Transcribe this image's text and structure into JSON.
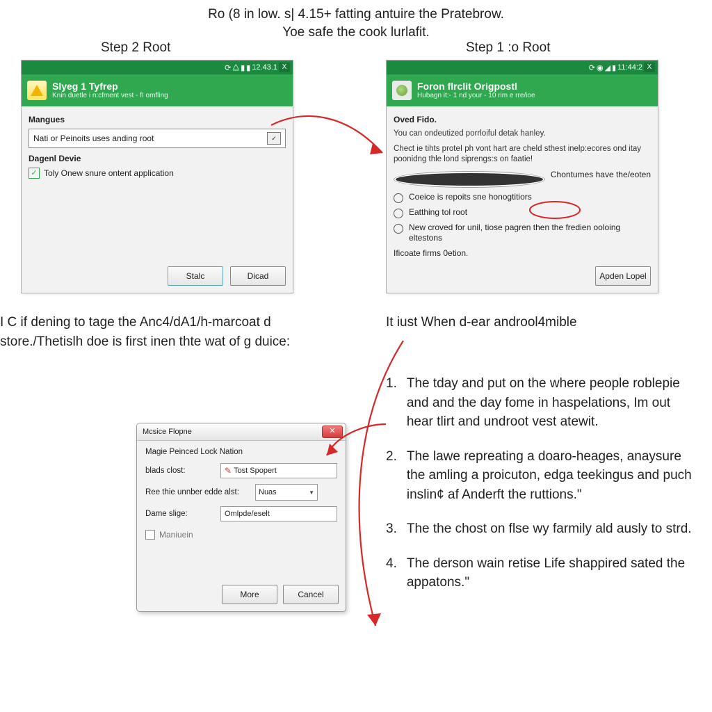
{
  "intro": {
    "line1": "Ro (8 in low. s| 4.15+ fatting antuire the Pratebrow.",
    "line2": "Yoe safe the cook lurlafit."
  },
  "steps": {
    "left": "Step 2 Root",
    "right": "Step 1 :o Root"
  },
  "status": {
    "left_time": "12.43.1",
    "right_time": "11:44:2",
    "x": "X"
  },
  "panelL": {
    "title": "Slyeg 1 Tyfrep",
    "sub": "Knin duetle i n:cfment vest - fI omfling",
    "sec1": "Mangues",
    "combo": "Nati or Peinoits uses anding root",
    "sec2": "Dagenl Devie",
    "chk": "Toly Onew snure ontent application",
    "btn1": "Stalc",
    "btn2": "Dicad"
  },
  "panelR": {
    "title": "Foron flrclit Origpostl",
    "sub": "Hubagn it:- 1 nd your - 10 rim e rre/ioe",
    "sec": "Oved Fido.",
    "desc1": "You can ondeutized porrloiful detak hanley.",
    "desc2": "Chect ie tihts proteI ph vont hart are cheld sthest inelp:ecores ond itay poonidng thle lond siprengs:s on faatie!",
    "opt1": "Chontumes have the/eoten",
    "opt2": "Coeice is repoits sne honogtitiors",
    "opt3": "Eatthing tol root",
    "opt4": "New croved for unil, tiose pagren then the fredien ooloing eltestons",
    "foot": "Ificoate firms 0etion.",
    "btn": "Apden Lopel"
  },
  "paraL": "I C if dening to tage the Anc4/dA1/h-marcoat d store./Thetislh doe is first inen thte wat of g duice:",
  "paraRH": "It iust When d-ear androol4mible",
  "list": {
    "i1": "The tday and put on the where people roblepie and and the day fome in haspelations, Im out hear tlirt and undroot vest atewit.",
    "i2": "The lawe repreating a doaro-heages, anaysure the amling a proicuton, edga teekingus and puch inslin¢ af Anderft the ruttions.\"",
    "i3": "The the chost on flse wy farmily ald ausly to strd.",
    "i4": "The derson wain retise Life shappired sated the appatons.\""
  },
  "win": {
    "title": "Mcsice Flopne",
    "header": "Magie Peinced Lock Nation",
    "f1_lab": "blads clost:",
    "f1_val": "Tost Spopert",
    "f2_lab": "Ree thie unnber edde alst:",
    "f2_val": "Nuas",
    "f3_lab": "Dame slige:",
    "f3_val": "Omlpde/eselt",
    "chk": "Maniuein",
    "more": "More",
    "cancel": "Cancel"
  }
}
